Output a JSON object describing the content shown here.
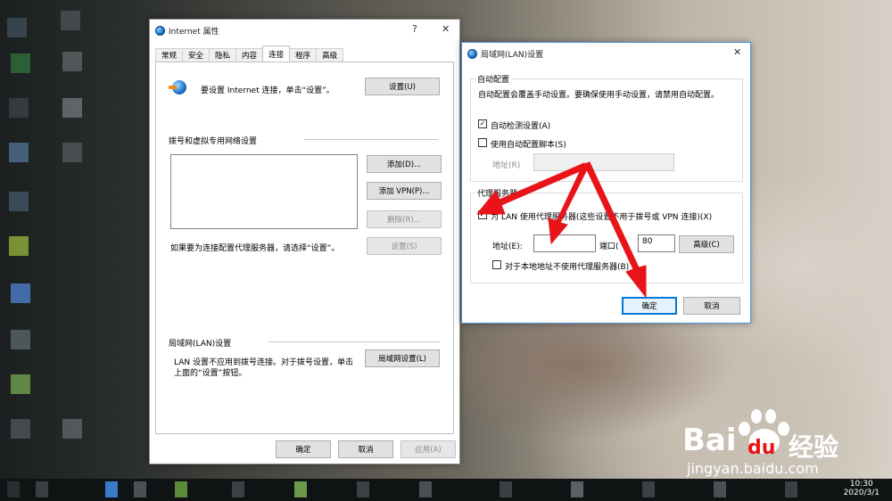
{
  "internet_props": {
    "title": "Internet 属性",
    "help_label": "?",
    "close_label": "✕",
    "tabs": [
      "常规",
      "安全",
      "隐私",
      "内容",
      "连接",
      "程序",
      "高级"
    ],
    "setup_text": "要设置 Internet 连接，单击“设置”。",
    "setup_button": "设置(U)",
    "dialup_section": "拨号和虚拟专用网络设置",
    "add_button": "添加(D)...",
    "add_vpn_button": "添加 VPN(P)...",
    "delete_button": "删除(R)...",
    "proxy_hint": "如果要为连接配置代理服务器，请选择“设置”。",
    "settings_button": "设置(S)",
    "lan_section": "局域网(LAN)设置",
    "lan_desc_1": "LAN 设置不应用到拨号连接。对于拨号设置，单击",
    "lan_desc_2": "上面的“设置”按钮。",
    "lan_button": "局域网设置(L)",
    "ok": "确定",
    "cancel": "取消",
    "apply": "应用(A)"
  },
  "lan_dialog": {
    "title": "局域网(LAN)设置",
    "close_label": "✕",
    "auto_config_section": "自动配置",
    "auto_config_desc": "自动配置会覆盖手动设置。要确保使用手动设置，请禁用自动配置。",
    "auto_detect": "自动检测设置(A)",
    "auto_detect_checked": "✓",
    "use_script": "使用自动配置脚本(S)",
    "address_label_disabled": "地址(R)",
    "proxy_section": "代理服务器",
    "use_proxy": "为 LAN 使用代理服务器(这些设置不用于拨号或 VPN 连接)(X)",
    "use_proxy_checked": "✓",
    "address_label": "地址(E):",
    "port_label": "端口(",
    "port_value": "80",
    "advanced_button": "高级(C)",
    "bypass_local": "对于本地地址不使用代理服务器(B)",
    "ok": "确定",
    "cancel": "取消"
  },
  "taskbar": {
    "time": "10:30",
    "date": "2020/3/1"
  },
  "watermark": {
    "brand": "Bai",
    "brand_tail": "du",
    "cn": "经验",
    "url": "jingyan.baidu.com"
  },
  "colors": {
    "accent": "#0078d7",
    "arrow": "#e8141a"
  }
}
